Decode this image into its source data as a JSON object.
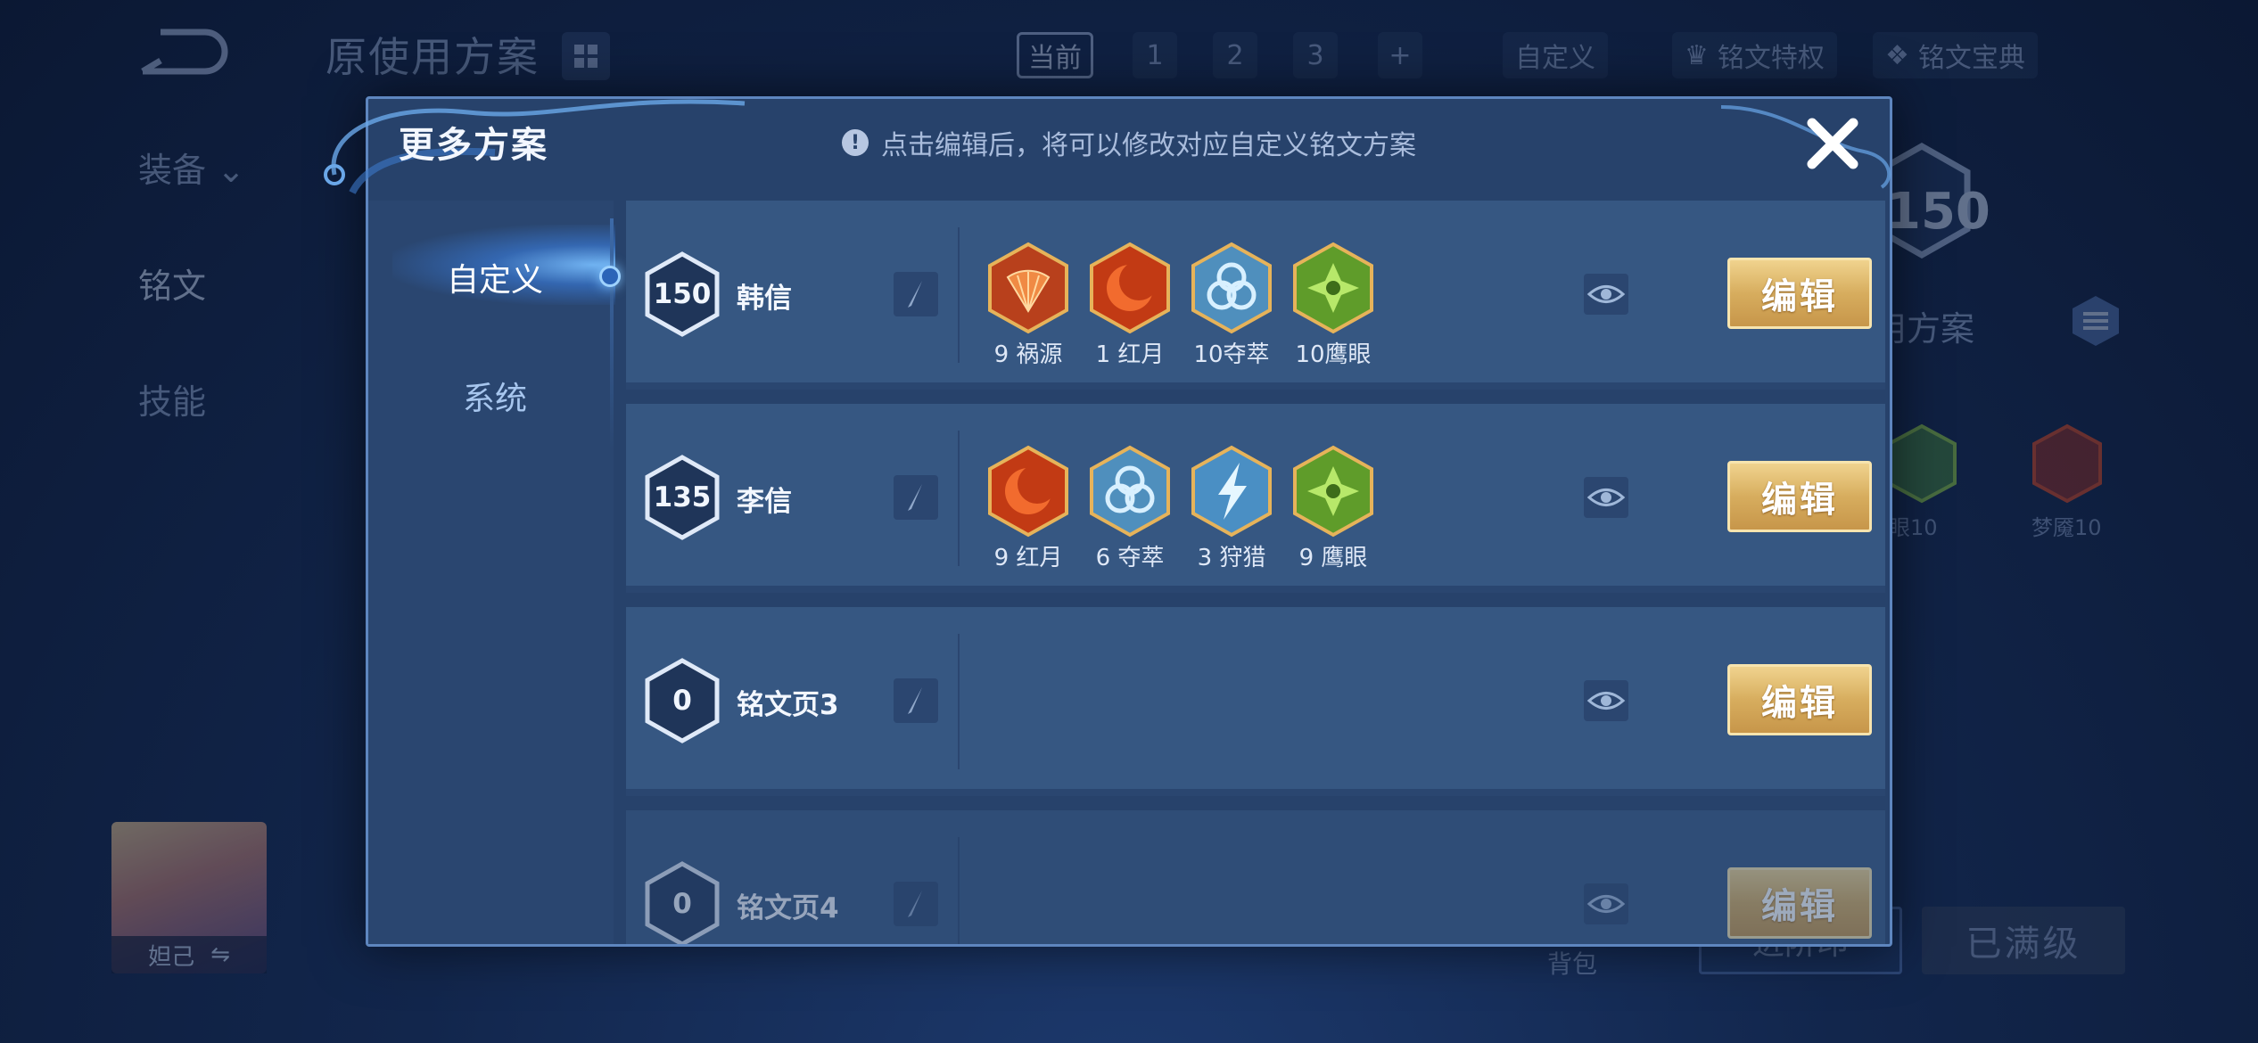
{
  "background": {
    "title": "原使用方案",
    "tabs": {
      "current": "当前",
      "n1": "1",
      "n2": "2",
      "n3": "3",
      "add": "+"
    },
    "custom_link": "自定义",
    "privilege_link": "铭文特权",
    "codex_link": "铭文宝典",
    "side_items": [
      "装备",
      "铭文",
      "技能"
    ],
    "level_badge": "150",
    "scheme_text": "用方案",
    "gem_labels": [
      "眼10",
      "梦魇10"
    ],
    "hero_name": "妲己",
    "bag_label": "背包",
    "button_left": "进阶印",
    "button_right": "已满级"
  },
  "modal": {
    "title": "更多方案",
    "hint": "点击编辑后，将可以修改对应自定义铭文方案",
    "nav": [
      "自定义",
      "系统"
    ],
    "edit_label": "编辑",
    "rows": [
      {
        "level": "150",
        "name": "韩信",
        "gems": [
          {
            "label": "9 祸源",
            "color": "#e0682c",
            "icon": "fan-icon"
          },
          {
            "label": "1 红月",
            "color": "#d9461f",
            "icon": "moon-icon"
          },
          {
            "label": "10夺萃",
            "color": "#78b8e0",
            "icon": "knot-icon"
          },
          {
            "label": "10鹰眼",
            "color": "#8fc93e",
            "icon": "eye-gem-icon"
          }
        ]
      },
      {
        "level": "135",
        "name": "李信",
        "gems": [
          {
            "label": "9 红月",
            "color": "#d9461f",
            "icon": "moon-icon"
          },
          {
            "label": "6 夺萃",
            "color": "#78b8e0",
            "icon": "knot-icon"
          },
          {
            "label": "3 狩猎",
            "color": "#6fb6e6",
            "icon": "lightning-icon"
          },
          {
            "label": "9 鹰眼",
            "color": "#8fc93e",
            "icon": "eye-gem-icon"
          }
        ]
      },
      {
        "level": "0",
        "name": "铭文页3",
        "gems": []
      },
      {
        "level": "0",
        "name": "铭文页4",
        "gems": []
      }
    ]
  }
}
